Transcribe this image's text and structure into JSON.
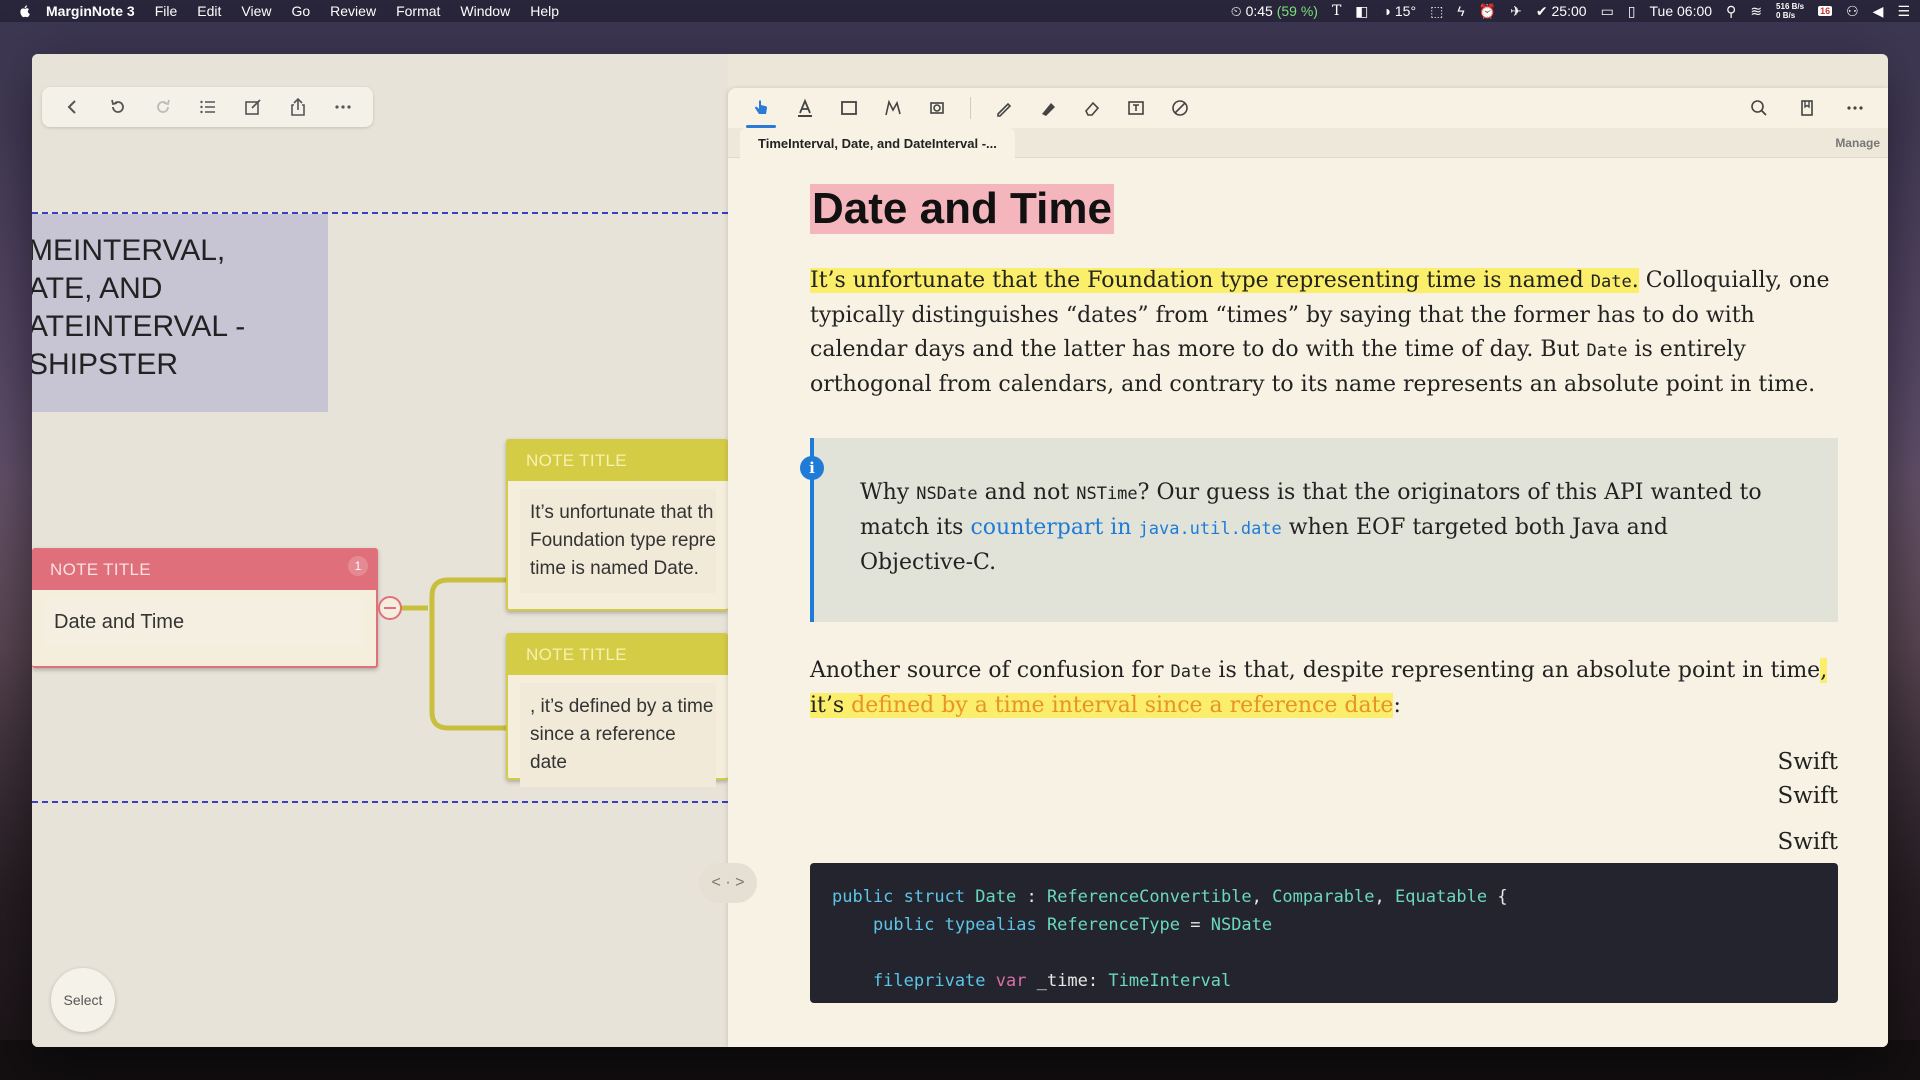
{
  "menubar": {
    "app": "MarginNote 3",
    "menus": [
      "File",
      "Edit",
      "View",
      "Go",
      "Review",
      "Format",
      "Window",
      "Help"
    ],
    "timer": "0:45",
    "battery_pct": "(59 %)",
    "temperature": "15°",
    "pomodoro": "25:00",
    "clock": "Tue 06:00",
    "net_up": "516 B/s",
    "net_down": "0 B/s",
    "calendar_day": "16"
  },
  "mindmap": {
    "title_lines": "MEINTERVAL,\nATE, AND\nATEINTERVAL -\nSHIPSTER",
    "main_note": {
      "header": "NOTE TITLE",
      "badge": "1",
      "body": "Date and Time"
    },
    "child_notes": [
      {
        "header": "NOTE TITLE",
        "body": "It’s unfortunate that th Foundation type repre time is named Date."
      },
      {
        "header": "NOTE TITLE",
        "body": ", it’s defined by a time since a reference date"
      }
    ],
    "select_label": "Select",
    "splitter_label": "< · >"
  },
  "document": {
    "tab_title": "TimeInterval, Date, and DateInterval -...",
    "manage_label": "Manage",
    "title": "Date and Time",
    "para1": {
      "highlighted": "It’s unfortunate that the Foundation type representing time is named ",
      "code": "Date",
      "highlighted_end": ".",
      "rest1": " Colloquially, one typically distinguishes “dates” from “times” by saying that the former has to do with calendar days and the latter has more to do with the time of day. But ",
      "code2": "Date",
      "rest2": " is entirely orthogonal from calendars, and contrary to its name represents an absolute point in time."
    },
    "info": {
      "icon": "i",
      "t1": "Why ",
      "c1": "NSDate",
      "t2": " and not ",
      "c2": "NSTime",
      "t3": "? Our guess is that the originators of this API wanted to match its ",
      "link_text": "counterpart in ",
      "link_code": "java.util.date",
      "t4": " when EOF targeted both Java and Objective-C."
    },
    "para2": {
      "t1": "Another source of confusion for ",
      "code": "Date",
      "t2": " is that, despite representing an absolute point in time",
      "hl1": ", it’s ",
      "hl_orange": "defined by a time interval since a reference date",
      "t3": ":"
    },
    "swift_labels": [
      "Swift",
      "Swift",
      "Swift"
    ],
    "code": {
      "l1_kw": "public struct ",
      "l1_name": "Date",
      "l1_sep": " : ",
      "l1_p1": "ReferenceConvertible",
      "l1_p2": "Comparable",
      "l1_p3": "Equatable",
      "l1_end": " {",
      "l2_kw": "    public typealias ",
      "l2_name": "ReferenceType",
      "l2_eq": " = ",
      "l2_val": "NSDate",
      "l4_kw": "    fileprivate ",
      "l4_var": "var",
      "l4_name": " _time",
      "l4_colon": ": ",
      "l4_type": "TimeInterval"
    }
  }
}
